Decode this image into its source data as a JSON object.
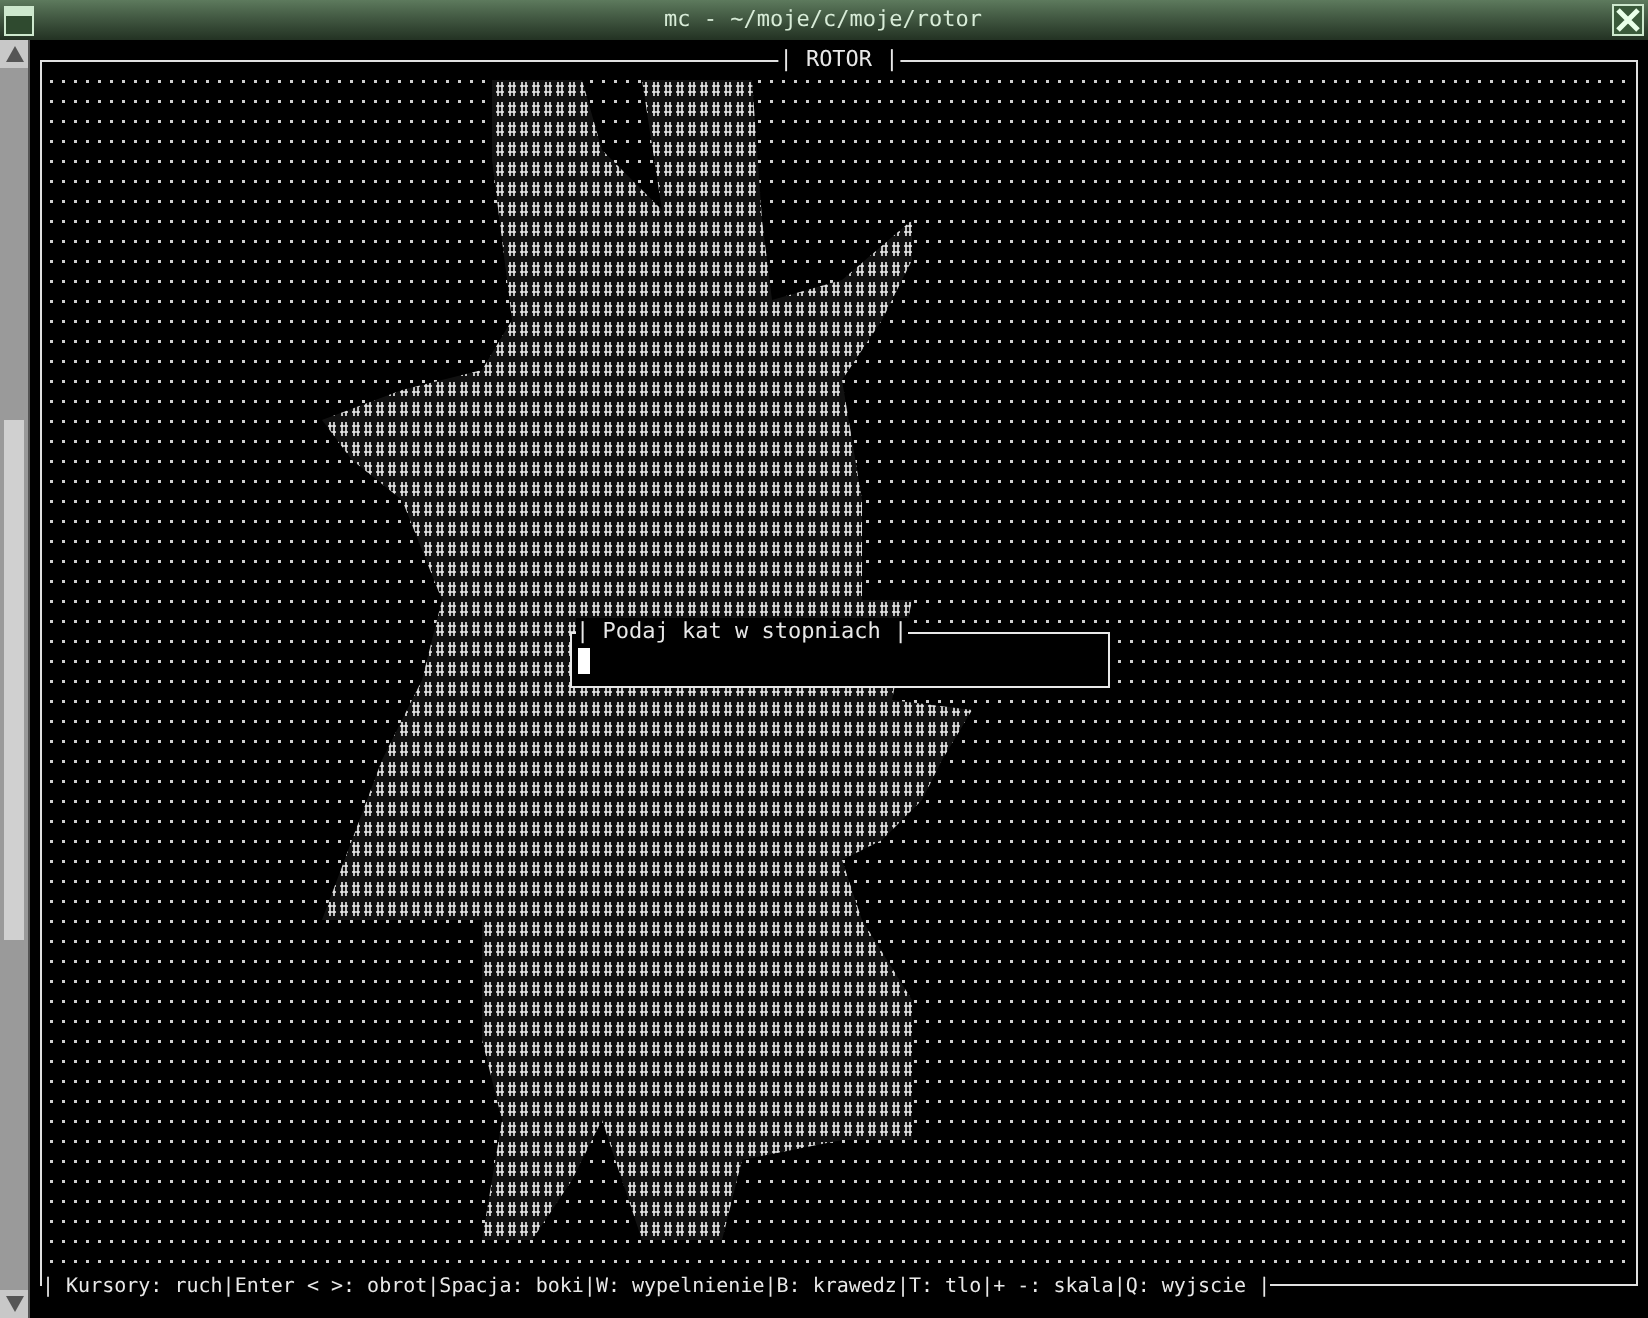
{
  "window": {
    "title": "mc - ~/moje/c/moje/rotor"
  },
  "panel": {
    "title": "| ROTOR |"
  },
  "dialog": {
    "title": "| Podaj kat w stopniach |",
    "cursor": true
  },
  "status_bar": "| Kursory: ruch|Enter < >: obrot|Spacja: boki|W: wypelnienie|B: krawedz|T: tlo|+ -: skala|Q: wyjscie |"
}
